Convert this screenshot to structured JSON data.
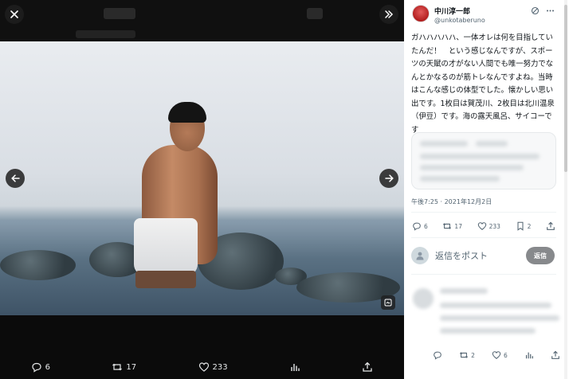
{
  "viewer": {
    "close_icon": "close-icon",
    "expand_icon": "double-chevron-right-icon",
    "prev_icon": "arrow-left-icon",
    "next_icon": "arrow-right-icon",
    "alt_icon": "alt-text-icon",
    "actions": [
      {
        "icon": "reply-icon",
        "count": "6"
      },
      {
        "icon": "retweet-icon",
        "count": "17"
      },
      {
        "icon": "like-icon",
        "count": "233"
      },
      {
        "icon": "views-icon",
        "count": ""
      },
      {
        "icon": "share-icon",
        "count": ""
      }
    ]
  },
  "post": {
    "author_name": "中川淳一郎",
    "author_handle": "@unkotaberuno",
    "text": "ガハハハハハ、一体オレは何を目指していたんだ！　という感じなんですが、スポーツの天賦の才がない人間でも唯一努力でなんとかなるのが筋トレなんですよね。当時はこんな感じの体型でした。懐かしい思い出です。1枚目は賀茂川、2枚目は北川温泉（伊豆）です。海の露天風呂、サイコーです",
    "timestamp": "午後7:25 · 2021年12月2日",
    "actions": [
      {
        "icon": "reply-icon",
        "count": "6"
      },
      {
        "icon": "retweet-icon",
        "count": "17"
      },
      {
        "icon": "like-icon",
        "count": "233"
      },
      {
        "icon": "bookmark-icon",
        "count": "2"
      },
      {
        "icon": "share-icon",
        "count": ""
      }
    ]
  },
  "reply_box": {
    "placeholder": "返信をポスト",
    "button": "返信"
  },
  "reply_actions": [
    {
      "icon": "reply-icon",
      "count": ""
    },
    {
      "icon": "retweet-icon",
      "count": "2"
    },
    {
      "icon": "like-icon",
      "count": "6"
    },
    {
      "icon": "views-icon",
      "count": ""
    },
    {
      "icon": "share-icon",
      "count": ""
    }
  ]
}
